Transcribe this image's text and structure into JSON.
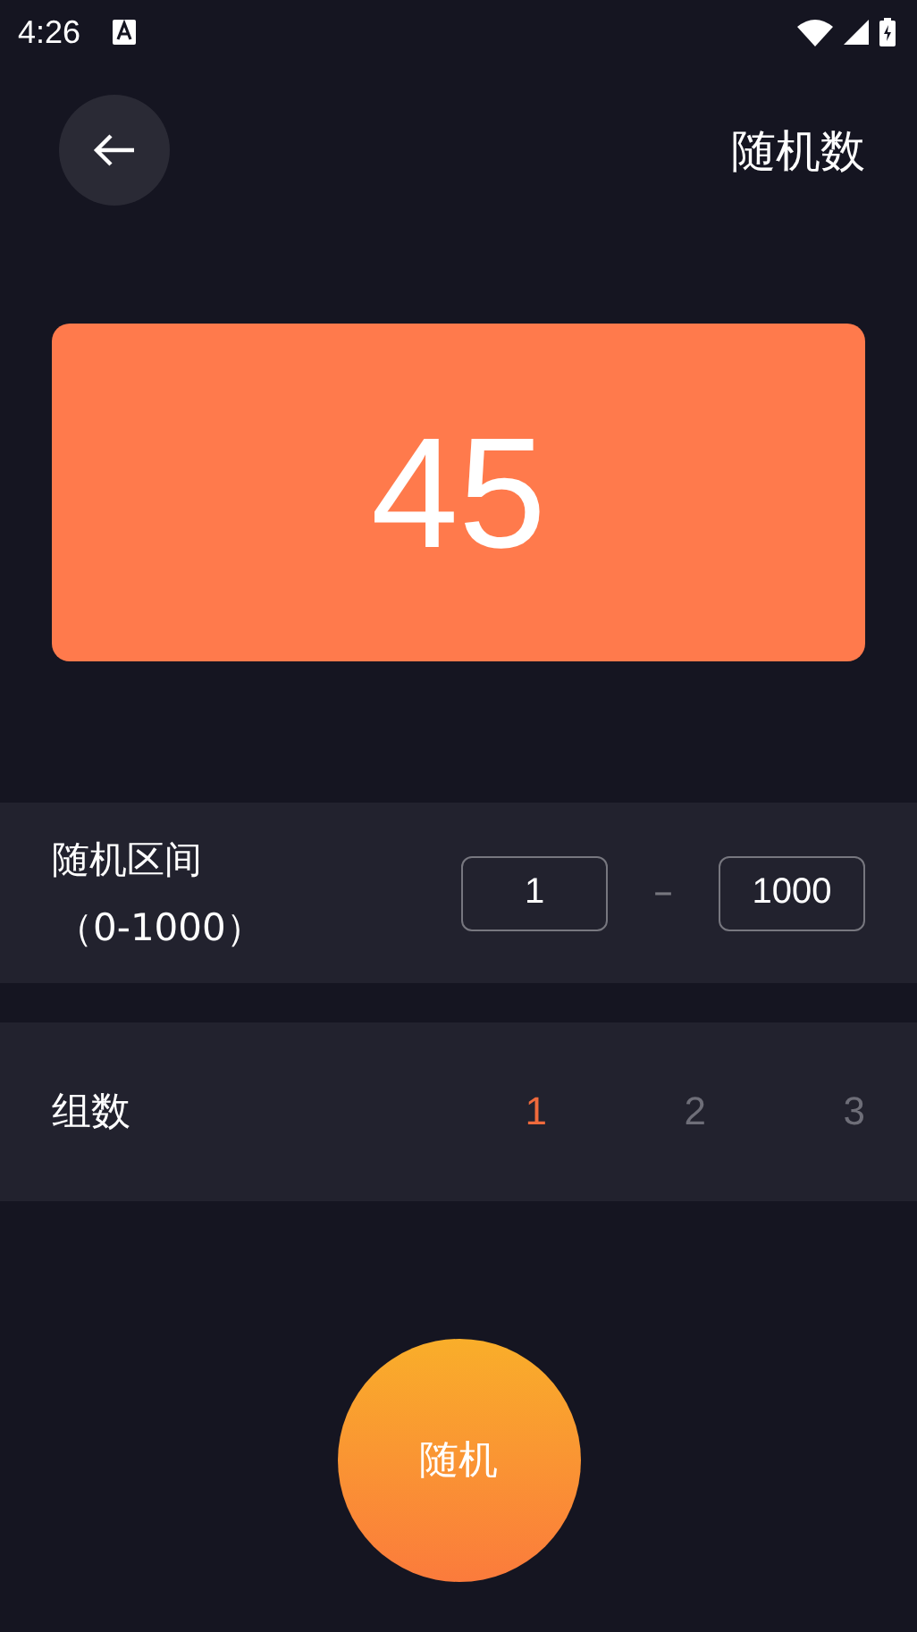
{
  "status_bar": {
    "time": "4:26"
  },
  "header": {
    "title": "随机数"
  },
  "result": {
    "value": "45"
  },
  "range": {
    "label": "随机区间",
    "hint": "（0-1000）",
    "min": "1",
    "separator": "–",
    "max": "1000"
  },
  "groups": {
    "label": "组数",
    "options": [
      {
        "label": "1",
        "selected": true
      },
      {
        "label": "2",
        "selected": false
      },
      {
        "label": "3",
        "selected": false
      }
    ]
  },
  "action": {
    "label": "随机"
  }
}
